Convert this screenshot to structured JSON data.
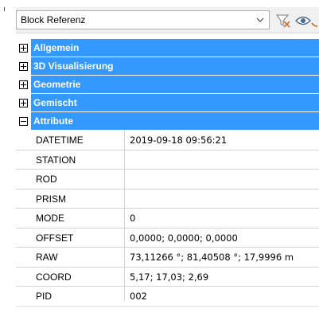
{
  "toolbar": {
    "selected_object": "Block Referenz",
    "icons": {
      "dropdown": "chevron-down-icon",
      "filter": "filter-icon",
      "visibility": "eye-icon"
    }
  },
  "categories": [
    {
      "label": "Allgemein",
      "expanded": false
    },
    {
      "label": "3D Visualisierung",
      "expanded": false
    },
    {
      "label": "Geometrie",
      "expanded": false
    },
    {
      "label": "Gemischt",
      "expanded": false
    },
    {
      "label": "Attribute",
      "expanded": true
    }
  ],
  "attributes": [
    {
      "name": "DATETIME",
      "value": "2019-09-18 09:56:21"
    },
    {
      "name": "STATION",
      "value": ""
    },
    {
      "name": "ROD",
      "value": ""
    },
    {
      "name": "PRISM",
      "value": ""
    },
    {
      "name": "MODE",
      "value": "0"
    },
    {
      "name": "OFFSET",
      "value": "0,0000; 0,0000; 0,0000"
    },
    {
      "name": "RAW",
      "value": "73,11266 °; 81,40508 °; 17,9996 m"
    },
    {
      "name": "COORD",
      "value": "5,17; 17,03; 2,69"
    },
    {
      "name": "PID",
      "value": "002"
    }
  ],
  "colors": {
    "category_bg": "#3399ff",
    "category_text": "#ffffff",
    "grid_line": "#d4d4d4"
  }
}
